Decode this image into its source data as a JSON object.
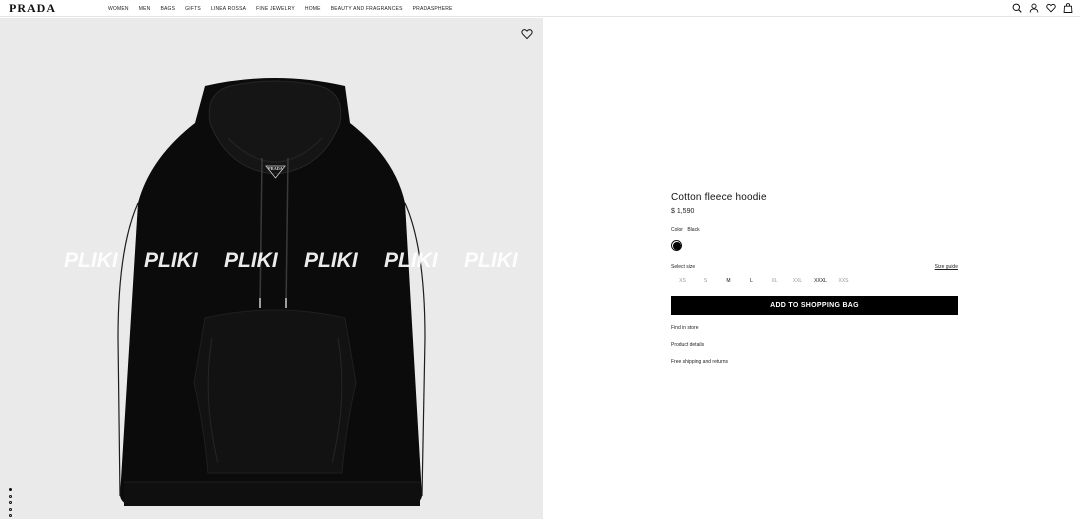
{
  "header": {
    "logo": "PRADA",
    "nav": [
      "WOMEN",
      "MEN",
      "BAGS",
      "GIFTS",
      "LINEA ROSSA",
      "FINE JEWELRY",
      "HOME",
      "BEAUTY AND FRAGRANCES",
      "PRADASPHERE"
    ],
    "icons": [
      "search-icon",
      "account-icon",
      "wishlist-icon",
      "bag-icon"
    ]
  },
  "product": {
    "title": "Cotton fleece hoodie",
    "price": "$ 1,590",
    "color_label": "Color",
    "color_value": "Black",
    "swatch_color": "#000000",
    "size_label": "Select size",
    "size_guide": "Size guide",
    "sizes": [
      {
        "label": "XS",
        "available": false
      },
      {
        "label": "S",
        "available": false
      },
      {
        "label": "M",
        "available": true
      },
      {
        "label": "L",
        "available": true
      },
      {
        "label": "XL",
        "available": false
      },
      {
        "label": "XXL",
        "available": false
      },
      {
        "label": "XXXL",
        "available": true
      },
      {
        "label": "XXS",
        "available": false
      }
    ],
    "add_button": "ADD TO SHOPPING BAG",
    "links": [
      "Find in store",
      "Product details",
      "Free shipping and returns"
    ]
  },
  "media": {
    "background_text": "PLIKI",
    "logo_tag": "PRADA",
    "slides": 5,
    "active_slide": 1
  }
}
